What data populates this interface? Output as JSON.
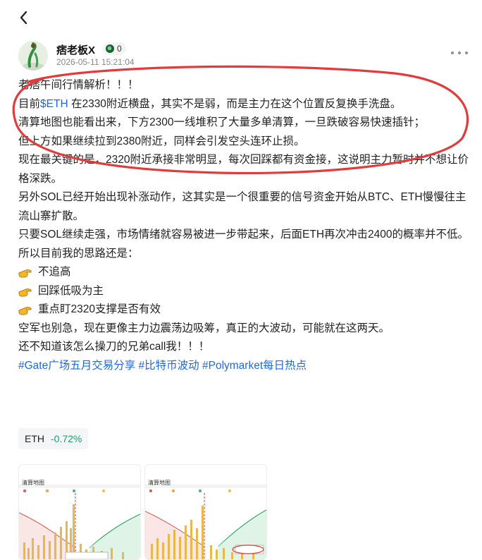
{
  "nav": {
    "back_icon": "chevron-left-icon"
  },
  "author": {
    "name": "痞老板X",
    "badge_count": "0",
    "timestamp": "2026-05-11 15:21:04"
  },
  "post": {
    "lines": {
      "l1": "老痞午间行情解析！！！",
      "l2_prefix": "目前",
      "l2_cashtag": "$ETH",
      "l2_rest": " 在2330附近横盘，其实不是弱，而是主力在这个位置反复换手洗盘。",
      "l3": "清算地图也能看出来，下方2300一线堆积了大量多单清算，一旦跌破容易快速插针；",
      "l4": "但上方如果继续拉到2380附近，同样会引发空头连环止损。",
      "l5": "现在最关键的是，2320附近承接非常明显，每次回踩都有资金接，这说明主力暂时并不想让价格深跌。",
      "l6": "另外SOL已经开始出现补涨动作，这其实是一个很重要的信号资金开始从BTC、ETH慢慢往主流山寨扩散。",
      "l7": "只要SOL继续走强，市场情绪就容易被进一步带起来，后面ETH再次冲击2400的概率并不低。",
      "l8": "所以目前我的思路还是：",
      "b1": "不追高",
      "b2": "回踩低吸为主",
      "b3": "重点盯2320支撑是否有效",
      "l9": "空军也别急，现在更像主力边震荡边吸筹，真正的大波动，可能就在这两天。",
      "l10": "还不知道该怎么操刀的兄弟call我！！！"
    },
    "hashtags": {
      "t1": "#Gate广场五月交易分享",
      "t2": "#比特币波动",
      "t3": "#Polymarket每日热点"
    }
  },
  "ticker": {
    "symbol": "ETH",
    "change": "-0.72%"
  },
  "images": {
    "img1_title": "清算地图",
    "img2_title": "清算地图"
  },
  "colors": {
    "link": "#1e68e6",
    "positive": "#1aa36a",
    "annotation": "#e23b3b"
  }
}
